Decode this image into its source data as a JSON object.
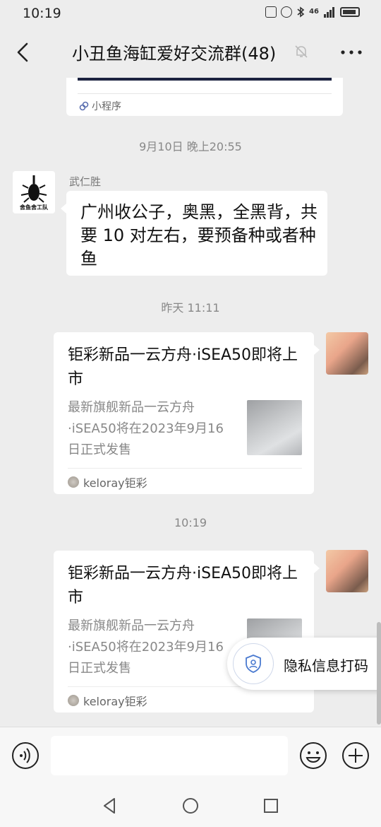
{
  "status": {
    "time": "10:19",
    "network": "46"
  },
  "header": {
    "title": "小丑鱼海缸爱好交流群(48)"
  },
  "top_card": {
    "source": "小程序"
  },
  "timestamps": [
    "9月10日 晚上20:55",
    "昨天 11:11",
    "10:19"
  ],
  "messages": {
    "text_msg": {
      "sender": "武仁胜",
      "text": "广州收公子，奥黑，全黑背，共要 10 对左右，要预备种或者种鱼",
      "avatar_text": "舍鱼舍工队"
    },
    "card1": {
      "title": "钜彩新品一云方舟·iSEA50即将上市",
      "desc": "最新旗舰新品一云方舟·iSEA50将在2023年9月16日正式发售",
      "source": "keloray钜彩"
    },
    "card2": {
      "title": "钜彩新品一云方舟·iSEA50即将上市",
      "desc": "最新旗舰新品一云方舟·iSEA50将在2023年9月16日正式发售",
      "source": "keloray钜彩"
    }
  },
  "privacy_button": {
    "label": "隐私信息打码"
  }
}
